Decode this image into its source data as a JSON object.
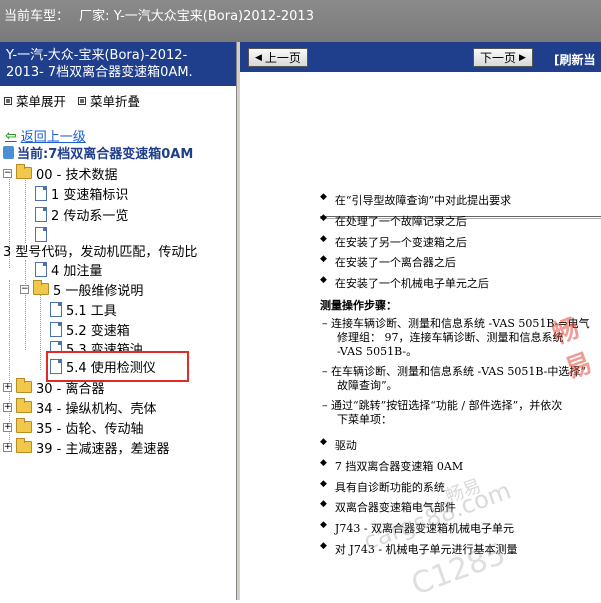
{
  "topbar": {
    "prefix": "当前车型：",
    "vendor_label": "厂家:",
    "vehicle": "Y-一汽大众宝来(Bora)2012-2013"
  },
  "left_header": {
    "line1": "Y-一汽-大众-宝来(Bora)-2012-",
    "line2": "2013- 7档双离合器变速箱0AM."
  },
  "menu": {
    "expand": "菜单展开",
    "collapse": "菜单折叠"
  },
  "back": "返回上一级",
  "current": "当前:7档双离合器变速箱0AM",
  "tree": [
    {
      "id": "n00",
      "label": "00 - 技术数据"
    },
    {
      "id": "n1",
      "label": "1 变速箱标识"
    },
    {
      "id": "n2",
      "label": "2 传动系一览"
    },
    {
      "id": "n3",
      "label": "3 型号代码，发动机匹配，传动比"
    },
    {
      "id": "n4",
      "label": "4 加注量"
    },
    {
      "id": "n5",
      "label": "5 一般维修说明"
    },
    {
      "id": "n51",
      "label": "5.1 工具"
    },
    {
      "id": "n52",
      "label": "5.2 变速箱"
    },
    {
      "id": "n53",
      "label": "5.3 变速箱油"
    },
    {
      "id": "n54",
      "label": "5.4 使用检测仪"
    },
    {
      "id": "n30",
      "label": "30 - 离合器"
    },
    {
      "id": "n34",
      "label": "34 - 操纵机构、壳体"
    },
    {
      "id": "n35",
      "label": "35 - 齿轮、传动轴"
    },
    {
      "id": "n39",
      "label": "39 - 主减速器，差速器"
    }
  ],
  "nav": {
    "prev": "上一页",
    "next": "下一页",
    "refresh": "[刷新当"
  },
  "content": {
    "bullets": [
      "在“引导型故障查询”中对此提出要求",
      "在处理了一个故障记录之后",
      "在安装了另一个变速箱之后",
      "在安装了一个离合器之后",
      "在安装了一个机械电子单元之后"
    ],
    "steps_title": "测量操作步骤：",
    "steps": [
      "连接车辆诊断、测量和信息系统 -VAS 5051B-⇒电气",
      "修理组：  97，连接车辆诊断、测量和信息系统",
      "-VAS 5051B-。",
      "在车辆诊断、测量和信息系统 -VAS 5051B-中选择“",
      "故障查询”。",
      "通过“跳转”按钮选择“功能 / 部件选择”，并依次",
      "下菜单项："
    ],
    "items": [
      "驱动",
      "7 挡双离合器变速箱 0AM",
      "具有自诊断功能的系统",
      "双离合器变速箱电气部件",
      "J743 - 双离合器变速箱机械电子单元",
      "对 J743 - 机械电子单元进行基本测量"
    ]
  },
  "watermark": {
    "w1": "畅易",
    "w2": "cargs88.com",
    "w3": "C1285"
  },
  "colors": {
    "header_blue": "#1f3f8c",
    "topbar_gray": "#888888",
    "highlight_red": "#e02b2b",
    "link_blue": "#1a5fd4"
  }
}
